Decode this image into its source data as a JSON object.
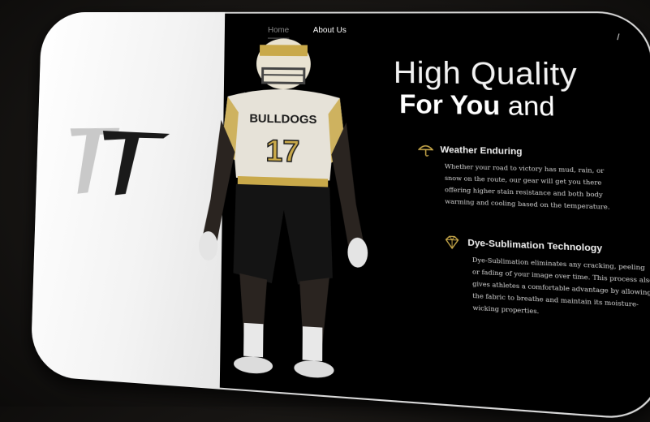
{
  "nav": {
    "items": [
      {
        "label": "Home"
      },
      {
        "label": "About Us"
      }
    ],
    "corner": "/"
  },
  "hero": {
    "headline_line1": "High Quality",
    "headline_line2_bold": "For You",
    "headline_line2_rest": " and"
  },
  "jersey": {
    "team": "BULLDOGS",
    "number": "17",
    "accent": "#c9a94a"
  },
  "features": [
    {
      "icon": "umbrella-icon",
      "title": "Weather Enduring",
      "lines": [
        "Whether your road to victory has mud, rain, or",
        "snow on the route, our gear will get you there",
        "offering higher stain resistance and both body",
        "warming and cooling based on the temperature."
      ]
    },
    {
      "icon": "diamond-icon",
      "title": "Dye-Sublimation Technology",
      "lines": [
        "Dye-Sublimation eliminates any cracking, peeling",
        "or fading of your image over time. This process also",
        "gives athletes a comfortable advantage by allowing",
        "the fabric to breathe and maintain its moisture-",
        "wicking properties."
      ]
    }
  ],
  "colors": {
    "background": "#000000",
    "logo_panel": "#ffffff",
    "gold": "#c9a94a"
  }
}
